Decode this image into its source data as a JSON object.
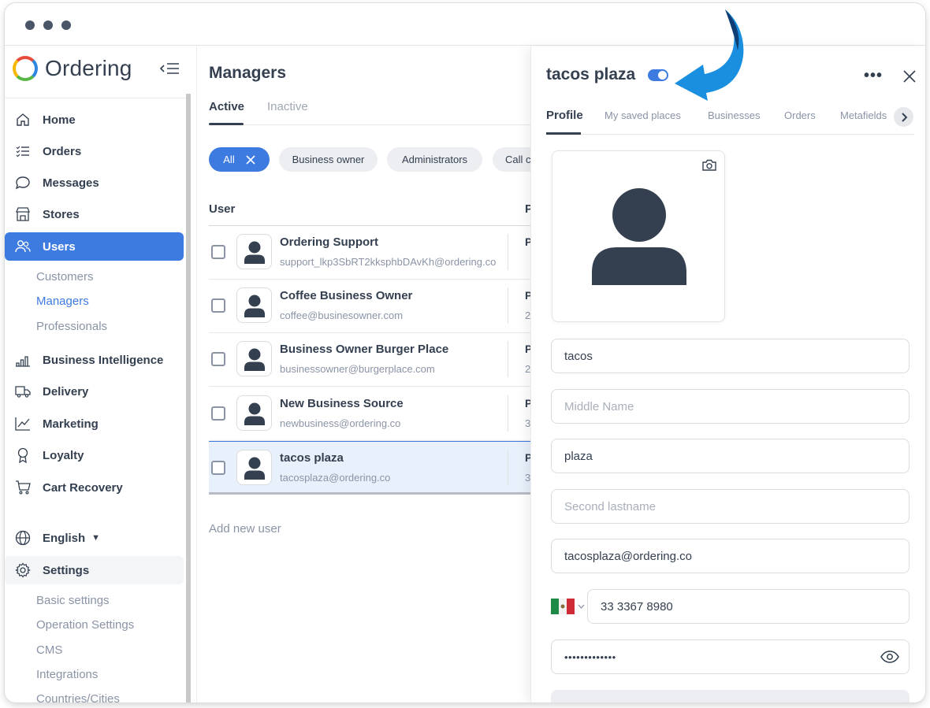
{
  "brand": {
    "name": "Ordering"
  },
  "sidebar": {
    "items": [
      {
        "label": "Home",
        "icon": "home-icon"
      },
      {
        "label": "Orders",
        "icon": "list-icon"
      },
      {
        "label": "Messages",
        "icon": "chat-icon"
      },
      {
        "label": "Stores",
        "icon": "store-icon"
      },
      {
        "label": "Users",
        "icon": "users-icon"
      },
      {
        "label": "Business Intelligence",
        "icon": "bar-chart-icon"
      },
      {
        "label": "Delivery",
        "icon": "truck-icon"
      },
      {
        "label": "Marketing",
        "icon": "trend-icon"
      },
      {
        "label": "Loyalty",
        "icon": "award-icon"
      },
      {
        "label": "Cart Recovery",
        "icon": "cart-icon"
      }
    ],
    "users_sub": [
      "Customers",
      "Managers",
      "Professionals"
    ],
    "language": "English",
    "settings_label": "Settings",
    "settings_sub": [
      "Basic settings",
      "Operation Settings",
      "CMS",
      "Integrations",
      "Countries/Cities"
    ]
  },
  "main": {
    "title": "Managers",
    "tabs": [
      "Active",
      "Inactive"
    ],
    "filters": [
      "All",
      "Business owner",
      "Administrators",
      "Call c"
    ],
    "columns": {
      "user": "User",
      "second": "P"
    },
    "rows": [
      {
        "name": "Ordering Support",
        "email": "support_lkp3SbRT2kksphbDAvKh@ordering.co",
        "col": "P",
        "col2": ""
      },
      {
        "name": "Coffee Business Owner",
        "email": "coffee@businesowner.com",
        "col": "P",
        "col2": "2"
      },
      {
        "name": "Business Owner Burger Place",
        "email": "businessowner@burgerplace.com",
        "col": "P",
        "col2": "2"
      },
      {
        "name": "New Business Source",
        "email": "newbusiness@ordering.co",
        "col": "P",
        "col2": "3"
      },
      {
        "name": "tacos plaza",
        "email": "tacosplaza@ordering.co",
        "col": "P",
        "col2": "3"
      }
    ],
    "add_user": "Add new user"
  },
  "panel": {
    "title": "tacos plaza",
    "active": true,
    "more": "•••",
    "tabs": [
      "Profile",
      "My saved places",
      "Businesses",
      "Orders",
      "Metafields"
    ],
    "fields": {
      "first_name": "tacos",
      "middle_name_placeholder": "Middle Name",
      "last_name": "plaza",
      "second_lastname_placeholder": "Second lastname",
      "email": "tacosplaza@ordering.co",
      "phone": "33 3367 8980",
      "password_mask": "•••••••••••••"
    }
  },
  "colors": {
    "accent": "#3d7be0",
    "text": "#344050",
    "muted": "#8a94a6",
    "arrow": "#1a8fe0"
  }
}
